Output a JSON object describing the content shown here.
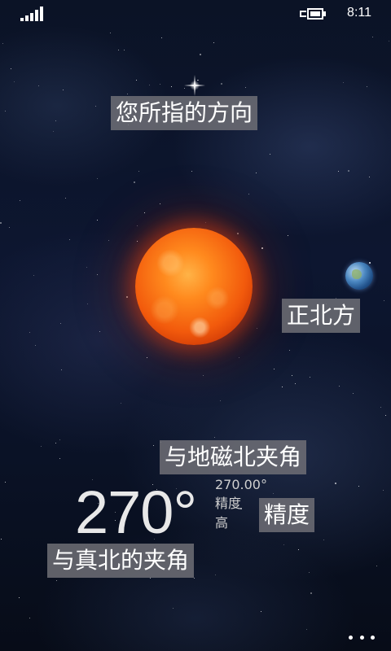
{
  "status_bar": {
    "time": "8:11",
    "signal_icon": "signal-bars-icon",
    "battery_icon": "battery-charging-icon"
  },
  "labels": {
    "pointing_direction": "您所指的方向",
    "true_north": "正北方",
    "magnetic_north_angle": "与地磁北夹角",
    "accuracy": "精度",
    "true_north_angle": "与真北的夹角"
  },
  "readout": {
    "true_north_angle_value": "270°",
    "magnetic_angle_value": "270.00°",
    "accuracy_label": "精度",
    "accuracy_value": "高"
  },
  "scene": {
    "north_star_icon": "north-star-icon",
    "sun_icon": "sun-icon",
    "earth_icon": "earth-icon"
  },
  "app_bar": {
    "more_icon": "ellipsis-more-icon"
  }
}
